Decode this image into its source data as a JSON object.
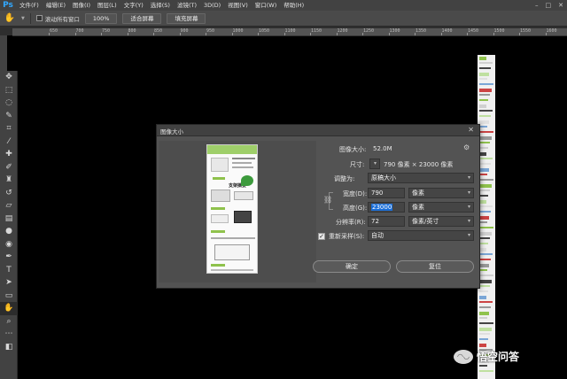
{
  "app": {
    "logo": "Ps"
  },
  "menu": [
    "文件(F)",
    "编辑(E)",
    "图像(I)",
    "图层(L)",
    "文字(Y)",
    "选择(S)",
    "滤镜(T)",
    "3D(D)",
    "视图(V)",
    "窗口(W)",
    "帮助(H)"
  ],
  "options_bar": {
    "scroll_all_windows": "滚动所有窗口",
    "zoom_100": "100%",
    "fit_screen": "适合屏幕",
    "fill_screen": "填充屏幕"
  },
  "ruler_labels": [
    "650",
    "700",
    "750",
    "800",
    "850",
    "900",
    "950",
    "1000",
    "1050",
    "1100",
    "1150",
    "1200",
    "1250",
    "1300",
    "1350",
    "1400",
    "1450",
    "1500",
    "1550",
    "1600",
    "1650"
  ],
  "dialog": {
    "title": "图像大小",
    "image_size_label": "图像大小:",
    "image_size_value": "52.0M",
    "dimensions_label": "尺寸:",
    "dimensions_value": "790 像素 × 23000 像素",
    "fit_to_label": "调整为:",
    "fit_to_value": "原稿大小",
    "width_label": "宽度(D):",
    "width_value": "790",
    "width_unit": "像素",
    "height_label": "高度(G):",
    "height_value": "23000",
    "height_unit": "像素",
    "resolution_label": "分辨率(R):",
    "resolution_value": "72",
    "resolution_unit": "像素/英寸",
    "resample_label": "重新采样(S):",
    "resample_value": "自动",
    "resample_checked": true,
    "ok_label": "确定",
    "cancel_label": "复位",
    "preview_heading": "支架摘要"
  },
  "watermark": {
    "text": "悟空问答"
  },
  "colors": {
    "menubar": "#424242",
    "dialog": "#535353",
    "selection": "#1a6ed8",
    "ps_blue": "#31a8ff"
  }
}
